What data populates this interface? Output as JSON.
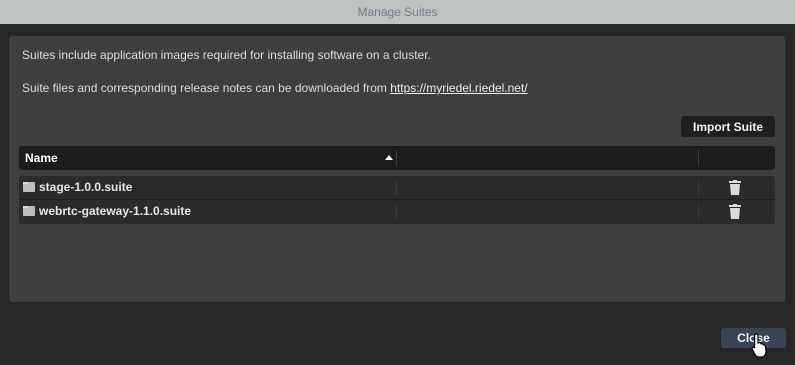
{
  "window": {
    "title": "Manage Suites"
  },
  "info": {
    "line1": "Suites include application images required for installing software on a cluster.",
    "line2_prefix": "Suite files and corresponding release notes can be downloaded from ",
    "link_text": "https://myriedel.riedel.net/"
  },
  "toolbar": {
    "import_label": "Import Suite"
  },
  "table": {
    "columns": [
      "Name",
      "",
      ""
    ],
    "sort": "ascending",
    "rows": [
      {
        "name": "stage-1.0.0.suite",
        "icon": "file-icon",
        "action_icon": "trash-icon"
      },
      {
        "name": "webrtc-gateway-1.1.0.suite",
        "icon": "file-icon",
        "action_icon": "trash-icon"
      }
    ]
  },
  "footer": {
    "close_label": "Close"
  },
  "colors": {
    "titlebar": "#bfc2c3",
    "panel": "#3e3e3e",
    "close_button": "#3a4356"
  }
}
